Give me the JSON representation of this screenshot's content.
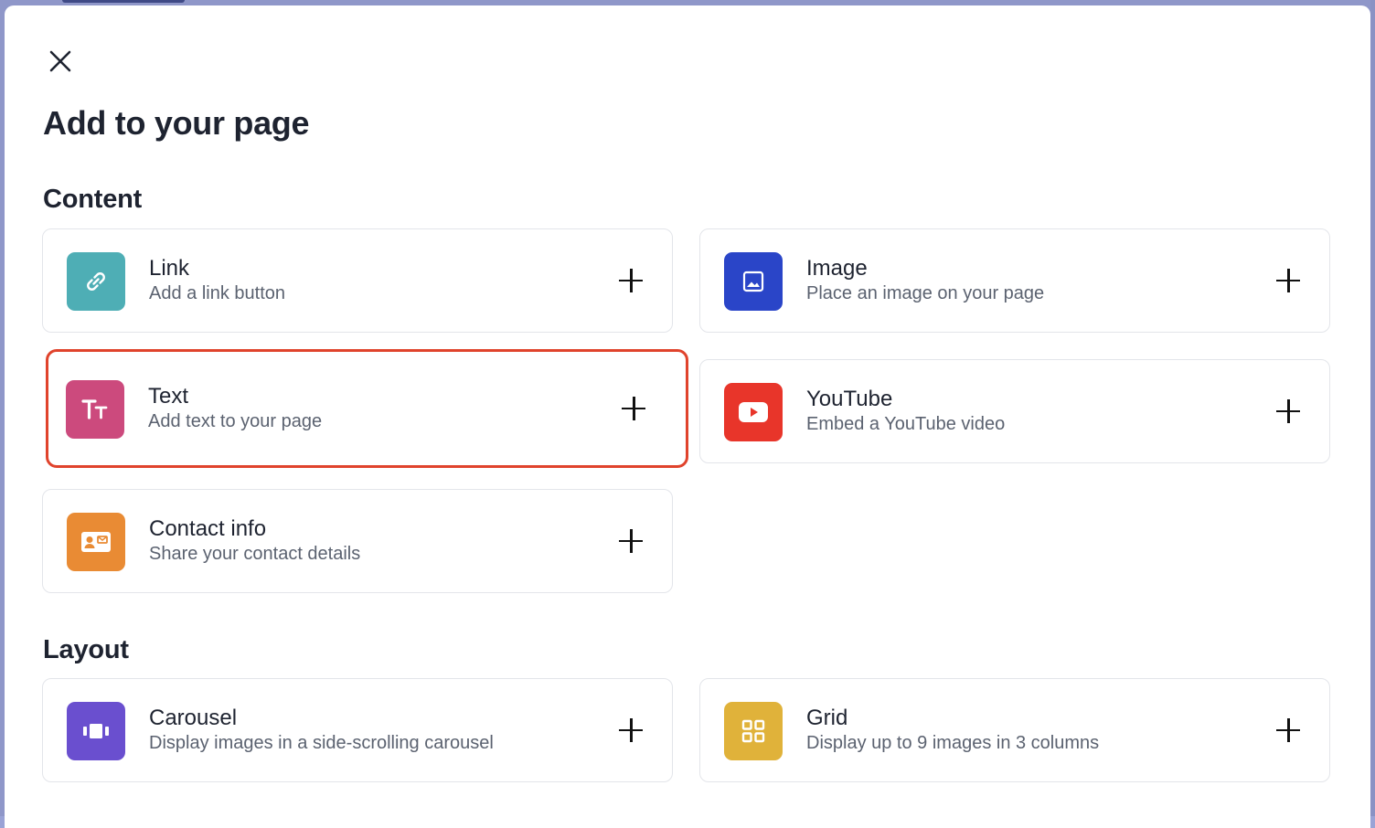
{
  "dialog": {
    "title": "Add to your page",
    "close_icon": "close-icon"
  },
  "sections": {
    "content": {
      "title": "Content",
      "items": {
        "link": {
          "title": "Link",
          "description": "Add a link button",
          "icon": "link-icon",
          "color": "#4eaeb5"
        },
        "image": {
          "title": "Image",
          "description": "Place an image on your page",
          "icon": "image-icon",
          "color": "#2a45c8"
        },
        "text": {
          "title": "Text",
          "description": "Add text to your page",
          "icon": "text-icon",
          "color": "#cc4a7d",
          "selected": true
        },
        "youtube": {
          "title": "YouTube",
          "description": "Embed a YouTube video",
          "icon": "youtube-icon",
          "color": "#e8352a"
        },
        "contact": {
          "title": "Contact info",
          "description": "Share your contact details",
          "icon": "contact-card-icon",
          "color": "#e98b34"
        }
      }
    },
    "layout": {
      "title": "Layout",
      "items": {
        "carousel": {
          "title": "Carousel",
          "description": "Display images in a side-scrolling carousel",
          "icon": "carousel-icon",
          "color": "#6a4fcf"
        },
        "grid": {
          "title": "Grid",
          "description": "Display up to 9 images in 3 columns",
          "icon": "grid-icon",
          "color": "#e0b23a"
        }
      }
    }
  },
  "highlight_color": "#e0432c"
}
